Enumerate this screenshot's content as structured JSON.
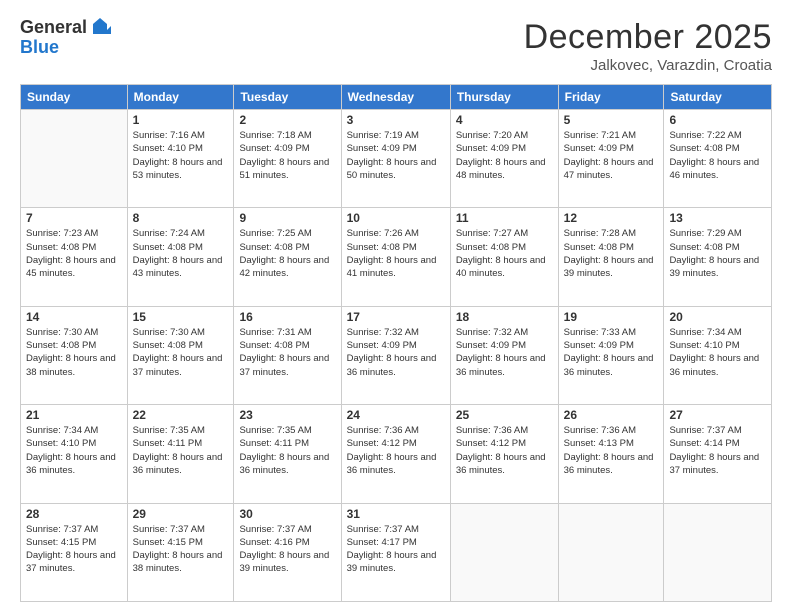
{
  "logo": {
    "general": "General",
    "blue": "Blue"
  },
  "title": "December 2025",
  "location": "Jalkovec, Varazdin, Croatia",
  "days": [
    "Sunday",
    "Monday",
    "Tuesday",
    "Wednesday",
    "Thursday",
    "Friday",
    "Saturday"
  ],
  "weeks": [
    [
      {
        "date": "",
        "sunrise": "",
        "sunset": "",
        "daylight": ""
      },
      {
        "date": "1",
        "sunrise": "Sunrise: 7:16 AM",
        "sunset": "Sunset: 4:10 PM",
        "daylight": "Daylight: 8 hours and 53 minutes."
      },
      {
        "date": "2",
        "sunrise": "Sunrise: 7:18 AM",
        "sunset": "Sunset: 4:09 PM",
        "daylight": "Daylight: 8 hours and 51 minutes."
      },
      {
        "date": "3",
        "sunrise": "Sunrise: 7:19 AM",
        "sunset": "Sunset: 4:09 PM",
        "daylight": "Daylight: 8 hours and 50 minutes."
      },
      {
        "date": "4",
        "sunrise": "Sunrise: 7:20 AM",
        "sunset": "Sunset: 4:09 PM",
        "daylight": "Daylight: 8 hours and 48 minutes."
      },
      {
        "date": "5",
        "sunrise": "Sunrise: 7:21 AM",
        "sunset": "Sunset: 4:09 PM",
        "daylight": "Daylight: 8 hours and 47 minutes."
      },
      {
        "date": "6",
        "sunrise": "Sunrise: 7:22 AM",
        "sunset": "Sunset: 4:08 PM",
        "daylight": "Daylight: 8 hours and 46 minutes."
      }
    ],
    [
      {
        "date": "7",
        "sunrise": "Sunrise: 7:23 AM",
        "sunset": "Sunset: 4:08 PM",
        "daylight": "Daylight: 8 hours and 45 minutes."
      },
      {
        "date": "8",
        "sunrise": "Sunrise: 7:24 AM",
        "sunset": "Sunset: 4:08 PM",
        "daylight": "Daylight: 8 hours and 43 minutes."
      },
      {
        "date": "9",
        "sunrise": "Sunrise: 7:25 AM",
        "sunset": "Sunset: 4:08 PM",
        "daylight": "Daylight: 8 hours and 42 minutes."
      },
      {
        "date": "10",
        "sunrise": "Sunrise: 7:26 AM",
        "sunset": "Sunset: 4:08 PM",
        "daylight": "Daylight: 8 hours and 41 minutes."
      },
      {
        "date": "11",
        "sunrise": "Sunrise: 7:27 AM",
        "sunset": "Sunset: 4:08 PM",
        "daylight": "Daylight: 8 hours and 40 minutes."
      },
      {
        "date": "12",
        "sunrise": "Sunrise: 7:28 AM",
        "sunset": "Sunset: 4:08 PM",
        "daylight": "Daylight: 8 hours and 39 minutes."
      },
      {
        "date": "13",
        "sunrise": "Sunrise: 7:29 AM",
        "sunset": "Sunset: 4:08 PM",
        "daylight": "Daylight: 8 hours and 39 minutes."
      }
    ],
    [
      {
        "date": "14",
        "sunrise": "Sunrise: 7:30 AM",
        "sunset": "Sunset: 4:08 PM",
        "daylight": "Daylight: 8 hours and 38 minutes."
      },
      {
        "date": "15",
        "sunrise": "Sunrise: 7:30 AM",
        "sunset": "Sunset: 4:08 PM",
        "daylight": "Daylight: 8 hours and 37 minutes."
      },
      {
        "date": "16",
        "sunrise": "Sunrise: 7:31 AM",
        "sunset": "Sunset: 4:08 PM",
        "daylight": "Daylight: 8 hours and 37 minutes."
      },
      {
        "date": "17",
        "sunrise": "Sunrise: 7:32 AM",
        "sunset": "Sunset: 4:09 PM",
        "daylight": "Daylight: 8 hours and 36 minutes."
      },
      {
        "date": "18",
        "sunrise": "Sunrise: 7:32 AM",
        "sunset": "Sunset: 4:09 PM",
        "daylight": "Daylight: 8 hours and 36 minutes."
      },
      {
        "date": "19",
        "sunrise": "Sunrise: 7:33 AM",
        "sunset": "Sunset: 4:09 PM",
        "daylight": "Daylight: 8 hours and 36 minutes."
      },
      {
        "date": "20",
        "sunrise": "Sunrise: 7:34 AM",
        "sunset": "Sunset: 4:10 PM",
        "daylight": "Daylight: 8 hours and 36 minutes."
      }
    ],
    [
      {
        "date": "21",
        "sunrise": "Sunrise: 7:34 AM",
        "sunset": "Sunset: 4:10 PM",
        "daylight": "Daylight: 8 hours and 36 minutes."
      },
      {
        "date": "22",
        "sunrise": "Sunrise: 7:35 AM",
        "sunset": "Sunset: 4:11 PM",
        "daylight": "Daylight: 8 hours and 36 minutes."
      },
      {
        "date": "23",
        "sunrise": "Sunrise: 7:35 AM",
        "sunset": "Sunset: 4:11 PM",
        "daylight": "Daylight: 8 hours and 36 minutes."
      },
      {
        "date": "24",
        "sunrise": "Sunrise: 7:36 AM",
        "sunset": "Sunset: 4:12 PM",
        "daylight": "Daylight: 8 hours and 36 minutes."
      },
      {
        "date": "25",
        "sunrise": "Sunrise: 7:36 AM",
        "sunset": "Sunset: 4:12 PM",
        "daylight": "Daylight: 8 hours and 36 minutes."
      },
      {
        "date": "26",
        "sunrise": "Sunrise: 7:36 AM",
        "sunset": "Sunset: 4:13 PM",
        "daylight": "Daylight: 8 hours and 36 minutes."
      },
      {
        "date": "27",
        "sunrise": "Sunrise: 7:37 AM",
        "sunset": "Sunset: 4:14 PM",
        "daylight": "Daylight: 8 hours and 37 minutes."
      }
    ],
    [
      {
        "date": "28",
        "sunrise": "Sunrise: 7:37 AM",
        "sunset": "Sunset: 4:15 PM",
        "daylight": "Daylight: 8 hours and 37 minutes."
      },
      {
        "date": "29",
        "sunrise": "Sunrise: 7:37 AM",
        "sunset": "Sunset: 4:15 PM",
        "daylight": "Daylight: 8 hours and 38 minutes."
      },
      {
        "date": "30",
        "sunrise": "Sunrise: 7:37 AM",
        "sunset": "Sunset: 4:16 PM",
        "daylight": "Daylight: 8 hours and 39 minutes."
      },
      {
        "date": "31",
        "sunrise": "Sunrise: 7:37 AM",
        "sunset": "Sunset: 4:17 PM",
        "daylight": "Daylight: 8 hours and 39 minutes."
      },
      {
        "date": "",
        "sunrise": "",
        "sunset": "",
        "daylight": ""
      },
      {
        "date": "",
        "sunrise": "",
        "sunset": "",
        "daylight": ""
      },
      {
        "date": "",
        "sunrise": "",
        "sunset": "",
        "daylight": ""
      }
    ]
  ]
}
